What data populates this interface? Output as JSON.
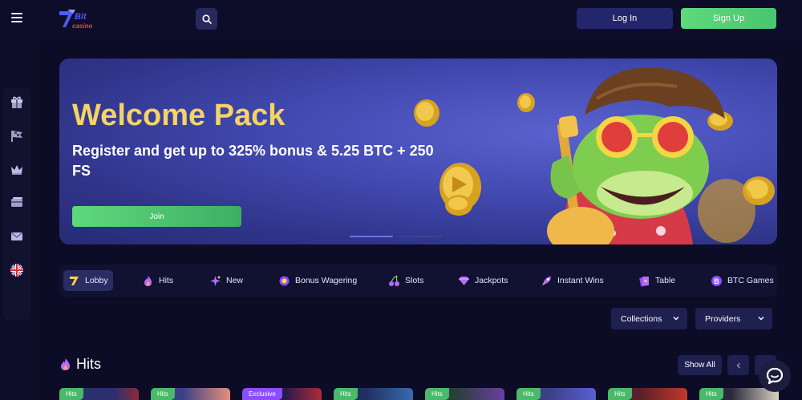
{
  "header": {
    "login_label": "Log In",
    "signup_label": "Sign Up",
    "brand_colors": {
      "accent_green": "#5ed97c",
      "navy": "#24266b"
    }
  },
  "sidebar": {
    "items": [
      {
        "icon": "gift-icon"
      },
      {
        "icon": "racing-flag-icon"
      },
      {
        "icon": "crown-icon"
      },
      {
        "icon": "card-icon"
      },
      {
        "icon": "mail-icon"
      },
      {
        "icon": "uk-flag-icon"
      }
    ]
  },
  "banner": {
    "title": "Welcome Pack",
    "subtitle": "Register and get up to 325% bonus & 5.25 BTC + 250 FS",
    "join_label": "Join"
  },
  "tabs": [
    {
      "label": "Lobby",
      "icon": "bitcasino-logo-icon",
      "active": true
    },
    {
      "label": "Hits",
      "icon": "fire-icon"
    },
    {
      "label": "New",
      "icon": "sparkle-star-icon"
    },
    {
      "label": "Bonus Wagering",
      "icon": "bonus-ring-icon"
    },
    {
      "label": "Slots",
      "icon": "cherries-icon"
    },
    {
      "label": "Jackpots",
      "icon": "diamond-icon"
    },
    {
      "label": "Instant Wins",
      "icon": "rocket-icon"
    },
    {
      "label": "Table",
      "icon": "cards-icon"
    },
    {
      "label": "BTC Games",
      "icon": "bitcoin-icon"
    }
  ],
  "filters": {
    "collections_label": "Collections",
    "providers_label": "Providers"
  },
  "section": {
    "title": "Hits",
    "show_all_label": "Show All"
  },
  "cards": [
    {
      "badge": "Hits"
    },
    {
      "badge": "Hits"
    },
    {
      "badge": "Exclusive"
    },
    {
      "badge": "Hits"
    },
    {
      "badge": "Hits"
    },
    {
      "badge": "Hits"
    },
    {
      "badge": "Hits"
    },
    {
      "badge": "Hits"
    }
  ]
}
